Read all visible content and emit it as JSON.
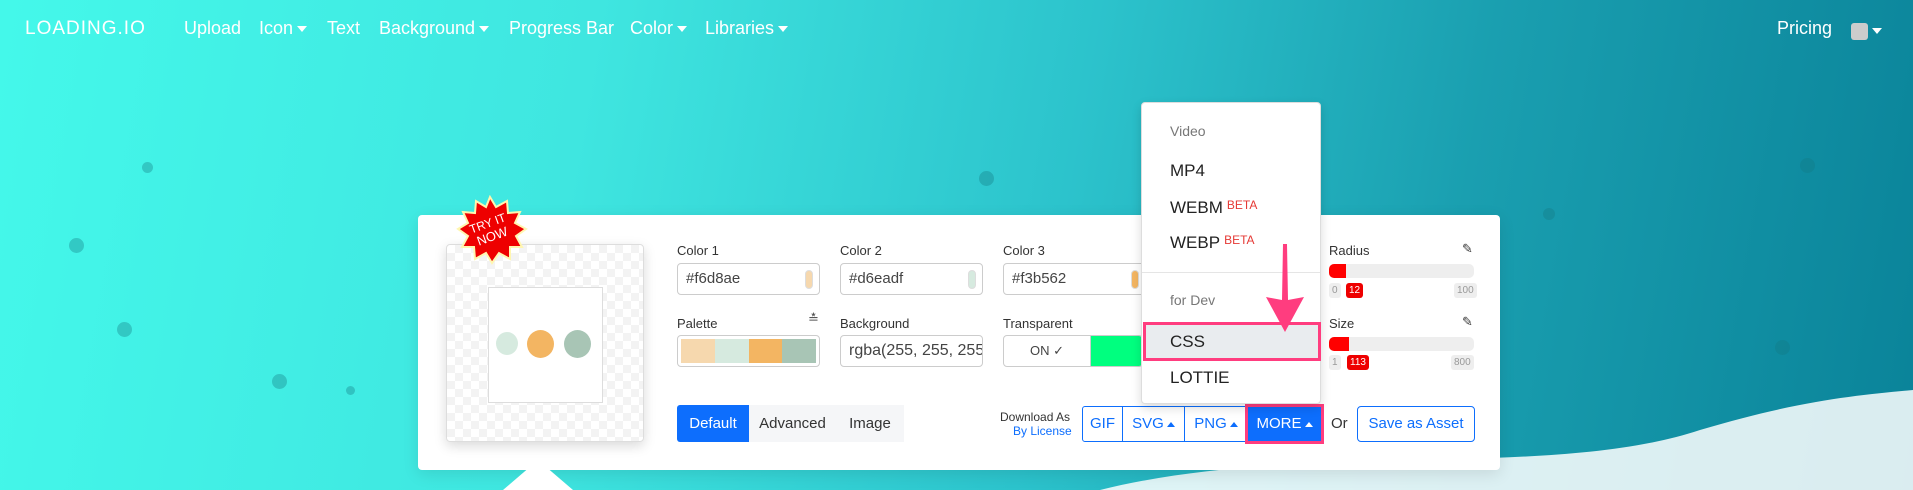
{
  "nav": {
    "logo": "LOADING.IO",
    "items": [
      {
        "label": "Upload"
      },
      {
        "label": "Icon",
        "caret": true
      },
      {
        "label": "Text"
      },
      {
        "label": "Background",
        "caret": true
      },
      {
        "label": "Progress Bar"
      },
      {
        "label": "Color",
        "caret": true
      },
      {
        "label": "Libraries",
        "caret": true
      }
    ],
    "pricing": "Pricing"
  },
  "badge": "TRY IT NOW",
  "colors": {
    "color1": {
      "label": "Color 1",
      "value": "#f6d8ae"
    },
    "color2": {
      "label": "Color 2",
      "value": "#d6eadf"
    },
    "color3": {
      "label": "Color 3",
      "value": "#f3b562"
    }
  },
  "palette": {
    "label": "Palette",
    "swatches": [
      "#f6d8ae",
      "#d6eadf",
      "#f3b562",
      "#a8c5b5"
    ]
  },
  "background": {
    "label": "Background",
    "value": "rgba(255, 255, 255"
  },
  "transparent": {
    "label": "Transparent",
    "value": "ON",
    "color": "#00ff7f"
  },
  "tabs": [
    "Default",
    "Advanced",
    "Image"
  ],
  "download": {
    "label": "Download As",
    "license": "By License",
    "gif": "GIF",
    "svg": "SVG",
    "png": "PNG",
    "more": "MORE",
    "or": "Or",
    "save": "Save as Asset"
  },
  "menu": {
    "video_header": "Video",
    "mp4": "MP4",
    "webm": "WEBM",
    "webp": "WEBP",
    "beta": "BETA",
    "dev_header": "for Dev",
    "css": "CSS",
    "lottie": "LOTTIE"
  },
  "radius": {
    "label": "Radius",
    "min": "0",
    "value": "12",
    "max": "100",
    "fraction": 0.12
  },
  "size": {
    "label": "Size",
    "min": "1",
    "value": "113",
    "max": "800",
    "fraction": 0.14
  }
}
